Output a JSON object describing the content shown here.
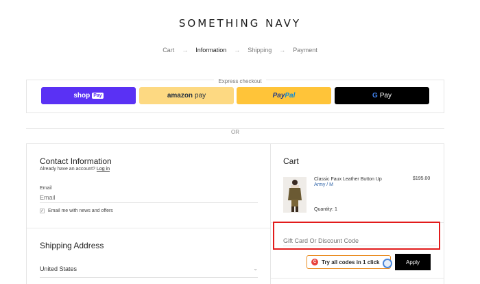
{
  "brand": {
    "logo_text": "SOMETHING NAVY"
  },
  "breadcrumb": {
    "steps": [
      "Cart",
      "Information",
      "Shipping",
      "Payment"
    ],
    "active": "Information",
    "separator": "→"
  },
  "express": {
    "label": "Express checkout",
    "shop_pay": {
      "text": "shop",
      "badge": "Pay"
    },
    "amazon_pay": {
      "brand": "amazon",
      "text": "pay"
    },
    "paypal": {
      "pay": "Pay",
      "pal": "Pal"
    },
    "gpay": {
      "g": "G",
      "text": "Pay"
    }
  },
  "or_text": "OR",
  "contact": {
    "title": "Contact Information",
    "have_account": "Already have an account?",
    "login_link": "Log in",
    "email_label": "Email",
    "email_placeholder": "Email",
    "newsletter_label": "Email me with news and offers",
    "newsletter_checked": true
  },
  "shipping": {
    "title": "Shipping Address",
    "country_value": "United States"
  },
  "cart": {
    "title": "Cart",
    "item": {
      "name": "Classic Faux Leather Button Up",
      "variant": "Army / M",
      "price": "$195.00",
      "quantity": "Quantity: 1"
    },
    "discount_placeholder": "Gift Card Or Discount Code",
    "try_codes_label": "Try all codes in 1 click",
    "apply_label": "Apply"
  },
  "colors": {
    "shop_pay": "#5a31f4",
    "amazon_pay": "#fdd982",
    "paypal": "#ffc439",
    "gpay": "#000000",
    "highlight": "#e21b1b",
    "apply": "#000000"
  }
}
